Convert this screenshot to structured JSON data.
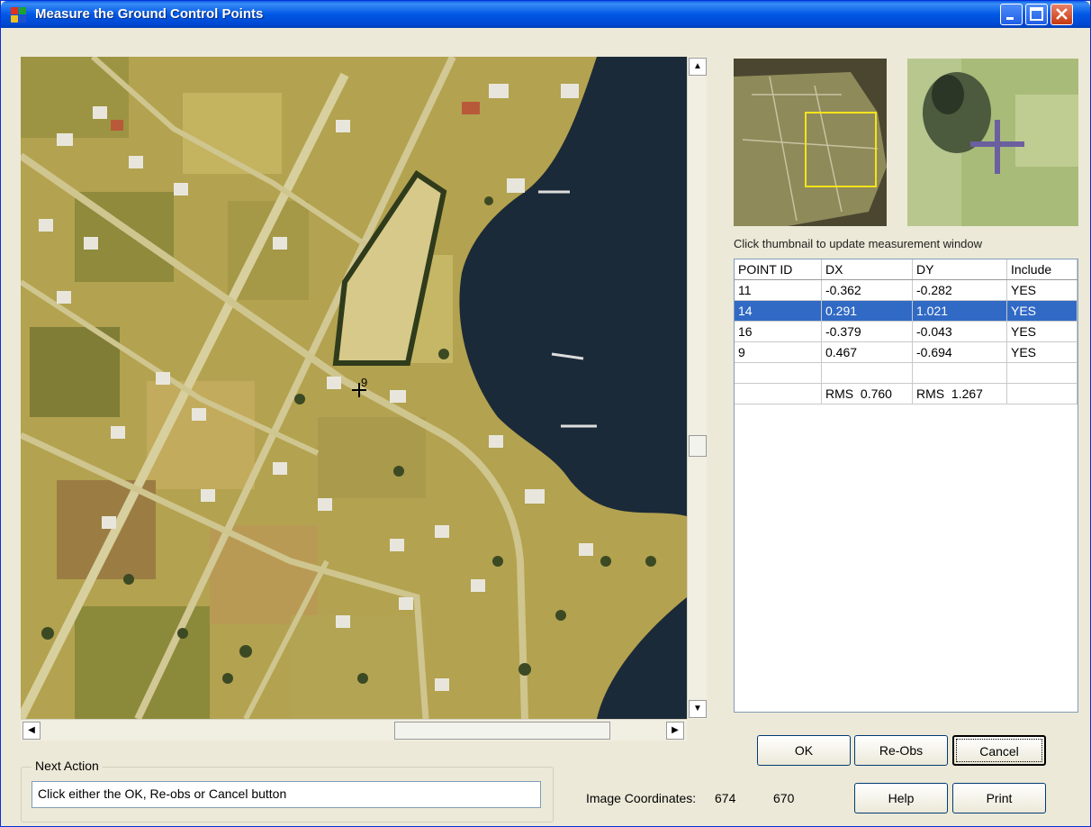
{
  "window": {
    "title": "Measure the Ground Control Points",
    "controls": {
      "minimize": "_",
      "maximize": "□",
      "close": "✕"
    }
  },
  "map": {
    "point_label": "9",
    "scroll_up_icon": "▲",
    "scroll_down_icon": "▼",
    "scroll_left_icon": "◀",
    "scroll_right_icon": "▶"
  },
  "thumbnail_hint": "Click thumbnail to update measurement window",
  "points_table": {
    "columns": [
      "POINT ID",
      "DX",
      "DY",
      "Include"
    ],
    "rows": [
      {
        "id": "11",
        "dx": "-0.362",
        "dy": "-0.282",
        "include": "YES",
        "selected": false
      },
      {
        "id": "14",
        "dx": "0.291",
        "dy": "1.021",
        "include": "YES",
        "selected": true
      },
      {
        "id": "16",
        "dx": "-0.379",
        "dy": "-0.043",
        "include": "YES",
        "selected": false
      },
      {
        "id": "9",
        "dx": "0.467",
        "dy": "-0.694",
        "include": "YES",
        "selected": false
      }
    ],
    "rms": {
      "dx_label": "RMS",
      "dx": "0.760",
      "dy_label": "RMS",
      "dy": "1.267"
    }
  },
  "buttons": {
    "ok": "OK",
    "reobs": "Re-Obs",
    "cancel": "Cancel",
    "help": "Help",
    "print": "Print"
  },
  "next_action": {
    "legend": "Next Action",
    "text": "Click either the OK, Re-obs or Cancel button"
  },
  "image_coordinates": {
    "label": "Image Coordinates:",
    "x": "674",
    "y": "670"
  },
  "colors": {
    "title_bar": "#0058e6",
    "selection": "#316ac5",
    "water": "#1b2a38",
    "field": "#b6a451"
  }
}
